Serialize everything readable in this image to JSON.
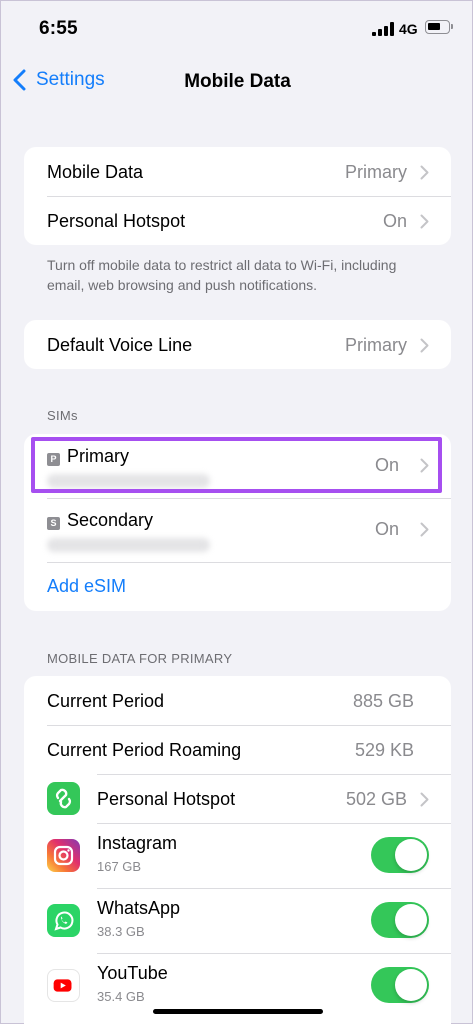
{
  "status_bar": {
    "time": "6:55",
    "network": "4G"
  },
  "nav": {
    "back_label": "Settings",
    "title": "Mobile Data"
  },
  "group1": {
    "rows": [
      {
        "label": "Mobile Data",
        "value": "Primary"
      },
      {
        "label": "Personal Hotspot",
        "value": "On"
      }
    ],
    "footnote": "Turn off mobile data to restrict all data to Wi-Fi, including email, web browsing and push notifications."
  },
  "group2": {
    "label": "Default Voice Line",
    "value": "Primary"
  },
  "sims": {
    "header": "SIMs",
    "items": [
      {
        "badge": "P",
        "name": "Primary",
        "value": "On",
        "highlighted": true
      },
      {
        "badge": "S",
        "name": "Secondary",
        "value": "On",
        "highlighted": false
      }
    ],
    "add_esim": "Add eSIM"
  },
  "usage": {
    "header": "MOBILE DATA FOR PRIMARY",
    "rows": [
      {
        "label": "Current Period",
        "value": "885 GB"
      },
      {
        "label": "Current Period Roaming",
        "value": "529 KB"
      },
      {
        "label": "Personal Hotspot",
        "value": "502 GB",
        "icon": "personal-hotspot-icon"
      }
    ],
    "apps": [
      {
        "name": "Instagram",
        "size": "167 GB",
        "icon": "instagram-icon",
        "enabled": true
      },
      {
        "name": "WhatsApp",
        "size": "38.3 GB",
        "icon": "whatsapp-icon",
        "enabled": true
      },
      {
        "name": "YouTube",
        "size": "35.4 GB",
        "icon": "youtube-icon",
        "enabled": true
      }
    ]
  },
  "colors": {
    "accent": "#147efb",
    "toggle_on": "#34c759",
    "highlight": "#a64ff0"
  }
}
